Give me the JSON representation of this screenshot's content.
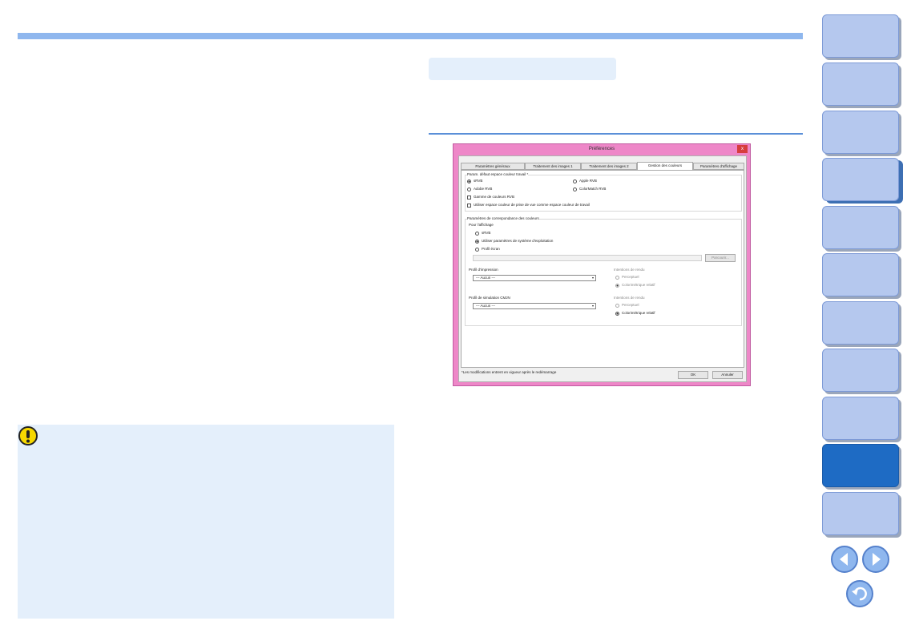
{
  "dialog": {
    "title": "Préférences",
    "close_label": "x",
    "tabs": [
      "Paramètres généraux",
      "Traitement des images 1",
      "Traitement des images 2",
      "Gestion des couleurs",
      "Paramètres d'affichage"
    ],
    "work_space": {
      "group_label": "Param. défaut espace couleur travail *",
      "options": [
        "sRVB",
        "Apple RVB",
        "Adobe RVB",
        "ColorMatch RVB"
      ],
      "selected": "sRVB",
      "checks": [
        "Gamme de couleurs RVB",
        "Utiliser espace couleur de prise de vue comme espace couleur de travail"
      ]
    },
    "matching": {
      "group_label": "Paramètres de correspondance des couleurs",
      "display_label": "Pour l'affichage",
      "display_options": [
        "sRVB",
        "Utiliser paramètres de système d'exploitation",
        "Profil écran"
      ],
      "display_selected": "Utiliser paramètres de système d'exploitation",
      "browse_label": "Parcourir...",
      "print_label": "Profil d'impression",
      "print_value": "--- Aucun ---",
      "print_intent_label": "Intentions de rendu",
      "cmyk_label": "Profil de simulation CMJN",
      "cmyk_value": "--- Aucun ---",
      "cmyk_intent_label": "Intentions de rendu",
      "intent_options": [
        "Perceptuel",
        "Colorimétrique relatif"
      ],
      "intent_selected": "Colorimétrique relatif"
    },
    "footnote": "*Les modifications entrent en vigueur après le redémarrage",
    "ok_label": "OK",
    "cancel_label": "Annuler"
  },
  "sidebar": {
    "tab_count": 11,
    "active_index": 9
  },
  "colors": {
    "accent": "#8fb7ee",
    "tab": "#b5c8ee",
    "tab_active": "#1e6bc4",
    "note_bg": "#e4effb",
    "dialog_frame": "#ee87c8"
  },
  "icons": {
    "caution": "caution-icon",
    "prev": "arrow-left-icon",
    "next": "arrow-right-icon",
    "back": "return-icon"
  }
}
